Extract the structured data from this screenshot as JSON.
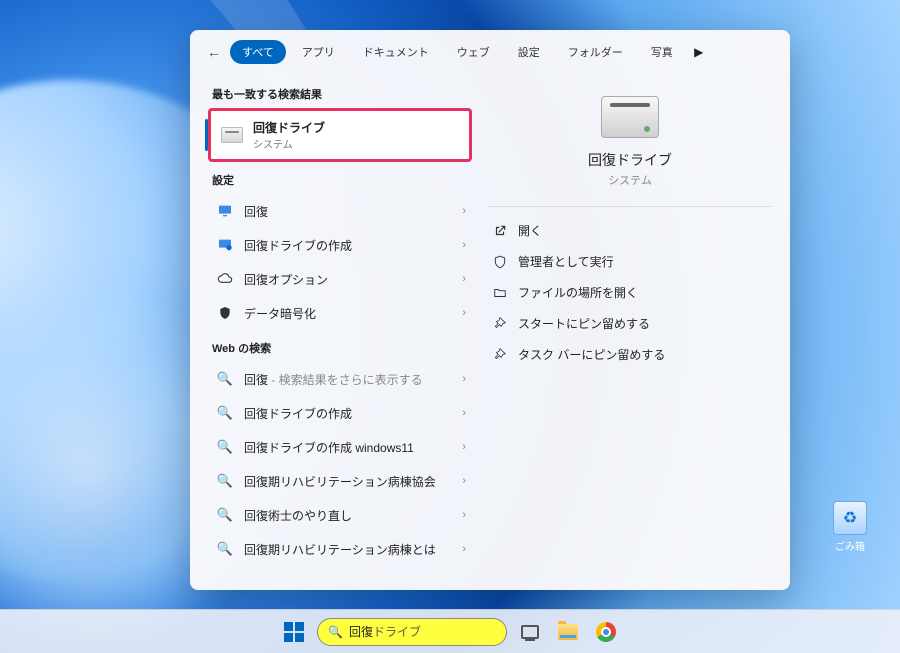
{
  "tabs": {
    "items": [
      "すべて",
      "アプリ",
      "ドキュメント",
      "ウェブ",
      "設定",
      "フォルダー",
      "写真"
    ],
    "active_index": 0
  },
  "best_match": {
    "section_label": "最も一致する検索結果",
    "title": "回復ドライブ",
    "subtitle": "システム"
  },
  "settings": {
    "section_label": "設定",
    "items": [
      {
        "icon": "recovery",
        "label": "回復"
      },
      {
        "icon": "create-drive",
        "label": "回復ドライブの作成"
      },
      {
        "icon": "options",
        "label": "回復オプション"
      },
      {
        "icon": "encrypt",
        "label": "データ暗号化"
      }
    ]
  },
  "web": {
    "section_label": "Web の検索",
    "items": [
      {
        "label": "回復",
        "hint": " - 検索結果をさらに表示する"
      },
      {
        "label": "回復ドライブの作成",
        "hint": ""
      },
      {
        "label": "回復ドライブの作成 windows11",
        "hint": ""
      },
      {
        "label": "回復期リハビリテーション病棟協会",
        "hint": ""
      },
      {
        "label": "回復術士のやり直し",
        "hint": ""
      },
      {
        "label": "回復期リハビリテーション病棟とは",
        "hint": ""
      }
    ]
  },
  "preview": {
    "title": "回復ドライブ",
    "subtitle": "システム",
    "actions": [
      {
        "icon": "open",
        "label": "開く"
      },
      {
        "icon": "admin",
        "label": "管理者として実行"
      },
      {
        "icon": "folder",
        "label": "ファイルの場所を開く"
      },
      {
        "icon": "pin-start",
        "label": "スタートにピン留めする"
      },
      {
        "icon": "pin-task",
        "label": "タスク バーにピン留めする"
      }
    ]
  },
  "taskbar": {
    "search_prefix": "回復",
    "search_suffix": "ドライブ"
  },
  "desktop": {
    "recycle_label": "ごみ箱"
  }
}
